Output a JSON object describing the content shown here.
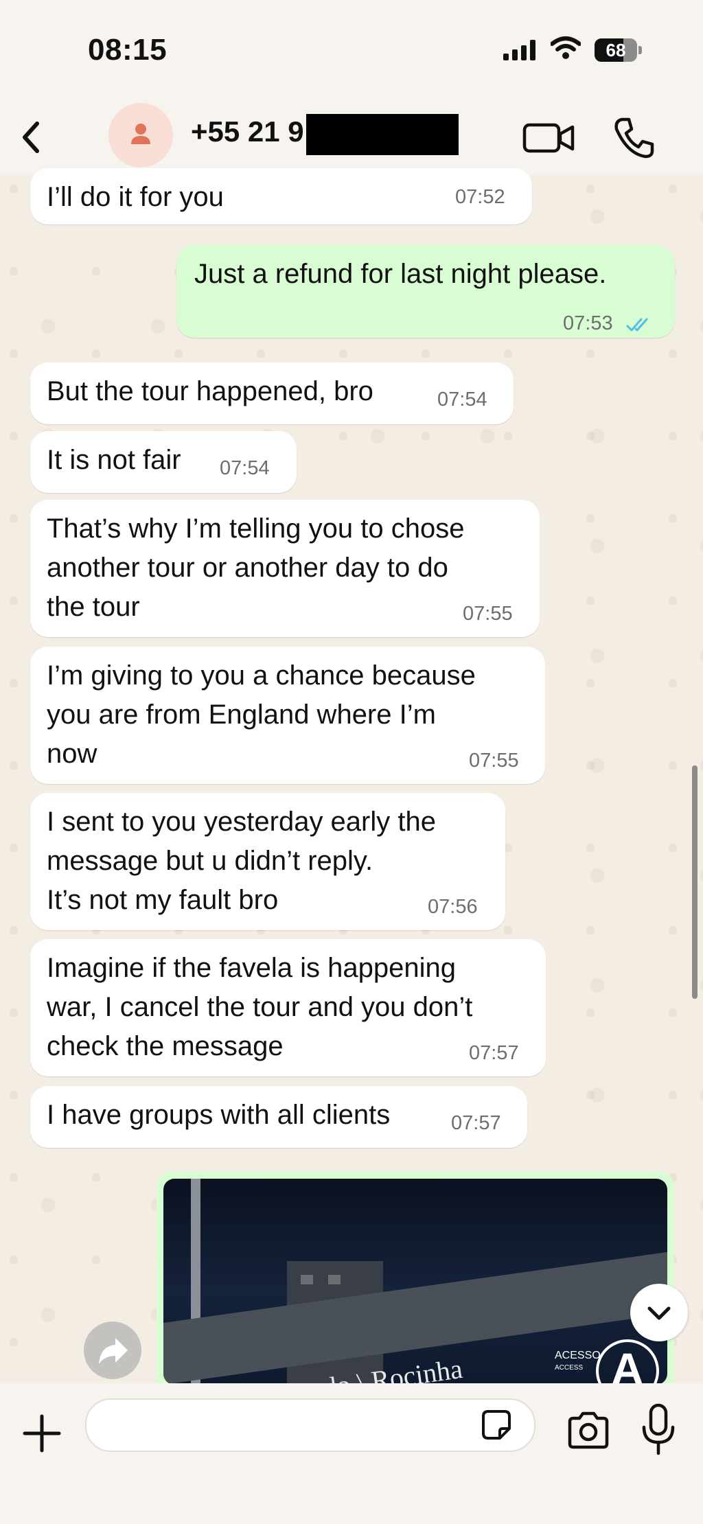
{
  "status_bar": {
    "time": "08:15",
    "battery": "68"
  },
  "header": {
    "contact": "+55 21 9"
  },
  "messages": [
    {
      "dir": "in",
      "text": "I’ll do it for you",
      "time": "07:52"
    },
    {
      "dir": "out",
      "text": "Just a refund for last night please.",
      "time": "07:53"
    },
    {
      "dir": "in",
      "text": "But the tour happened, bro",
      "time": "07:54"
    },
    {
      "dir": "in",
      "text": "It is not fair",
      "time": "07:54"
    },
    {
      "dir": "in",
      "text": "That’s why I’m telling you to chose\nanother tour or another day to do\nthe tour",
      "time": "07:55"
    },
    {
      "dir": "in",
      "text": "I’m giving to you a chance because\nyou are from England where I’m\nnow",
      "time": "07:55"
    },
    {
      "dir": "in",
      "text": "I sent to you yesterday early the\nmessage but u didn’t reply.\nIt’s not my fault bro",
      "time": "07:56"
    },
    {
      "dir": "in",
      "text": "Imagine if the favela is happening\nwar, I cancel the tour and you don’t\ncheck the message",
      "time": "07:57"
    },
    {
      "dir": "in",
      "text": "I have groups with all clients",
      "time": "07:57"
    }
  ],
  "media": {
    "sign_text": "São Conrado \\ Rocinha",
    "access_label": "ACESSO",
    "access_sub": "ACCESS",
    "letter": "A"
  },
  "colors": {
    "incoming": "#ffffff",
    "outgoing": "#d9fdd3",
    "read_ticks": "#53bdeb",
    "avatar": "#e2735a"
  }
}
